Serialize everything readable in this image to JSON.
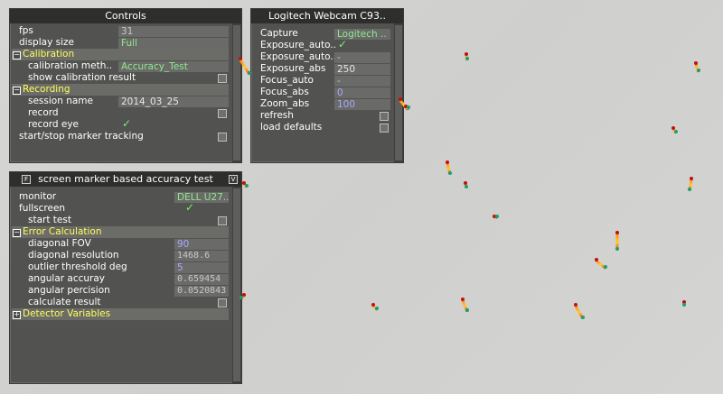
{
  "controls": {
    "title": "Controls",
    "fps_label": "fps",
    "fps_value": "31",
    "display_size_label": "display size",
    "display_size_value": "Full",
    "calibration_section": "Calibration",
    "calibration_method_label": "calibration meth..",
    "calibration_method_value": "Accuracy_Test",
    "show_calibration_result_label": "show calibration result",
    "recording_section": "Recording",
    "session_name_label": "session name",
    "session_name_value": "2014_03_25",
    "record_label": "record",
    "record_eye_label": "record eye",
    "marker_tracking_label": "start/stop marker tracking",
    "section_expanded_icon": "−"
  },
  "webcam": {
    "title": "Logitech Webcam C93..",
    "capture_label": "Capture",
    "capture_value": "Logitech ..",
    "exposure_auto1_label": "Exposure_auto..",
    "exposure_auto2_label": "Exposure_auto..",
    "exposure_auto2_value": "-",
    "exposure_abs_label": "Exposure_abs",
    "exposure_abs_value": "250",
    "focus_auto_label": "Focus_auto",
    "focus_auto_value": "-",
    "focus_abs_label": "Focus_abs",
    "focus_abs_value": "0",
    "zoom_abs_label": "Zoom_abs",
    "zoom_abs_value": "100",
    "refresh_label": "refresh",
    "load_defaults_label": "load defaults"
  },
  "accuracy": {
    "title": "screen marker based accuracy test",
    "title_btn_left": "F",
    "title_btn_right": "V",
    "monitor_label": "monitor",
    "monitor_value": "DELL U27..",
    "fullscreen_label": "fullscreen",
    "start_test_label": "start test",
    "error_section": "Error Calculation",
    "diagonal_fov_label": "diagonal FOV",
    "diagonal_fov_value": "90",
    "diagonal_resolution_label": "diagonal resolution",
    "diagonal_resolution_value": "1468.6",
    "outlier_label": "outlier threshold deg",
    "outlier_value": "5",
    "angular_accuracy_label": "angular accuray",
    "angular_accuracy_value": "0.659454",
    "angular_precision_label": "angular percision",
    "angular_precision_value": "0.0520843",
    "calculate_result_label": "calculate result",
    "detector_section": "Detector Variables",
    "section_collapsed_icon": "+"
  },
  "check_mark": "✓"
}
